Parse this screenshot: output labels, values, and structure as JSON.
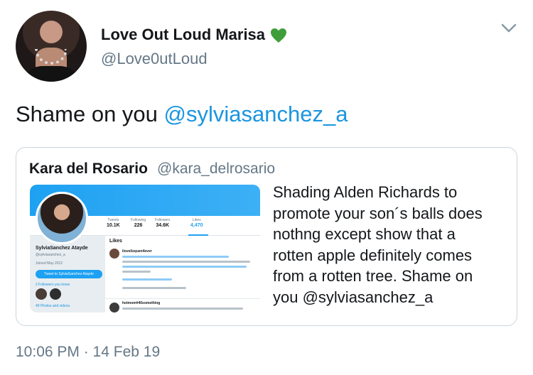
{
  "author": {
    "name": "Love Out Loud Marisa",
    "handle": "@Love0utLoud"
  },
  "tweet": {
    "text_prefix": "Shame on you ",
    "mention": "@sylviasanchez_a"
  },
  "quote": {
    "name": "Kara del Rosario",
    "handle": "@kara_delrosario",
    "lines": [
      "Shading Alden Richards to",
      "promote your son´s balls does",
      "nothng except show that a",
      "rotten apple definitely comes",
      "from a rotten tree. Shame on",
      "you @sylviasanchez_a"
    ],
    "image": {
      "profile_name": "SylviaSanchez Atayde",
      "profile_handle": "@sylviasanchez_a",
      "joined": "Joined May 2012",
      "tweet_to_button": "Tweet to SylviaSanchez Atayde",
      "followers_you_know": "2 Followers you know",
      "photos_videos": "49 Photos and videos",
      "stats": [
        {
          "label": "Tweets",
          "value": "10.1K"
        },
        {
          "label": "Following",
          "value": "226"
        },
        {
          "label": "Followers",
          "value": "34.6K"
        },
        {
          "label": "Likes",
          "value": "4,470"
        }
      ],
      "likes_heading": "Likes",
      "feed_user_1": "ilovelizquen4ever",
      "feed_user_2": "hotmom#40something"
    }
  },
  "timestamp": "10:06 PM · 14 Feb 19",
  "colors": {
    "heart": "#3f9e3a",
    "link": "#1b95e0",
    "secondary_text": "#657786",
    "border": "#ccd6dd"
  },
  "icons": {
    "heart": "green-heart-icon",
    "menu": "chevron-down-icon"
  }
}
